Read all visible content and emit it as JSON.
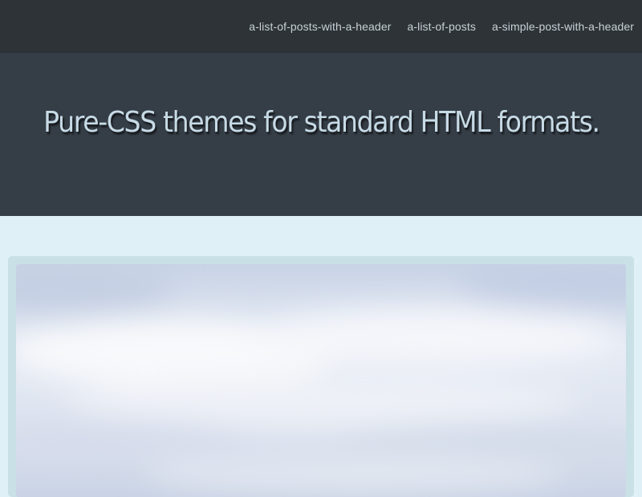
{
  "nav": {
    "links": [
      "a-list-of-posts-with-a-header",
      "a-list-of-posts",
      "a-simple-post-with-a-header"
    ]
  },
  "hero": {
    "title": "Pure-CSS themes for standard HTML formats."
  },
  "post": {
    "image": {
      "subject": "cloudy-sky-photo"
    }
  },
  "colors": {
    "nav_bg": "#2d3337",
    "hero_bg": "#353d46",
    "page_bg": "#dff1f6",
    "title_color": "#c7dbe6",
    "link_color": "#c9d1d6"
  }
}
